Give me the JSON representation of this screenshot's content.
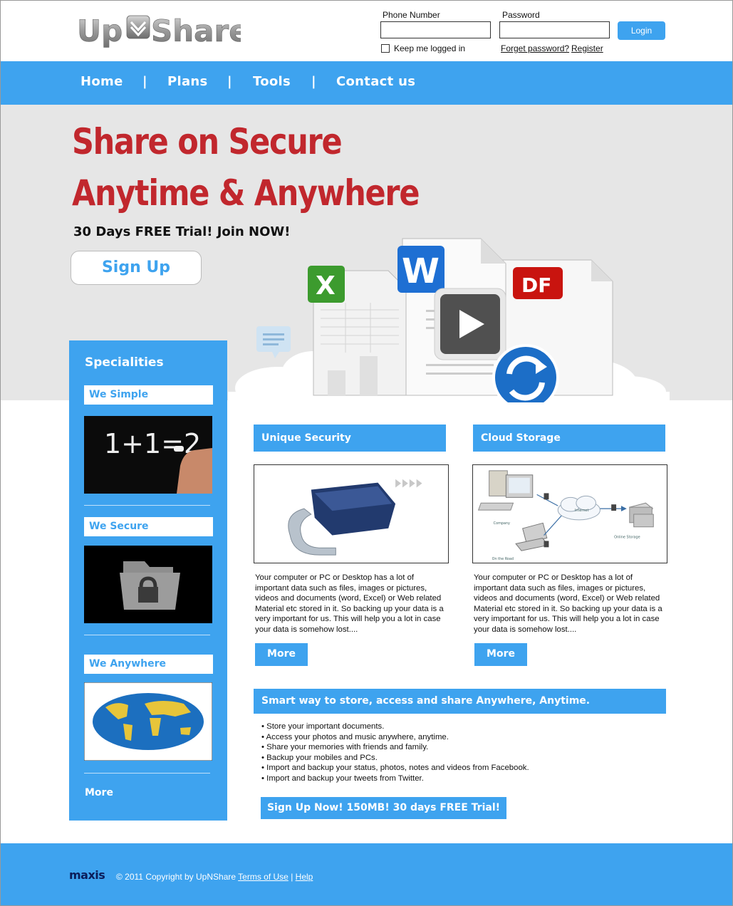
{
  "header": {
    "logo_text_left": "Up",
    "logo_text_right": "Share",
    "phone_label": "Phone Number",
    "password_label": "Password",
    "phone_value": "",
    "password_value": "",
    "login_label": "Login",
    "keep_logged_label": "Keep me logged in",
    "forgot_label": "Forget password?",
    "register_label": "Register"
  },
  "nav": {
    "items": [
      {
        "label": "Home"
      },
      {
        "label": "Plans"
      },
      {
        "label": "Tools"
      },
      {
        "label": "Contact us"
      }
    ],
    "separator": "|"
  },
  "hero": {
    "headline_1": "Share on Secure",
    "headline_2": "Anytime & Anywhere",
    "trial_text": "30 Days FREE Trial! Join NOW!",
    "signup_label": "Sign Up",
    "icon_excel": "X",
    "icon_word": "W",
    "icon_pdf": "DF"
  },
  "sidebar": {
    "title": "Specialities",
    "items": [
      {
        "label": "We Simple",
        "image_text": "1+1=2"
      },
      {
        "label": "We Secure"
      },
      {
        "label": "We Anywhere"
      }
    ],
    "more_label": "More"
  },
  "features": [
    {
      "title": "Unique Security",
      "text": "Your computer or PC or Desktop has a lot of important data such as files, images or pictures, videos and documents (word, Excel) or Web related Material etc stored in it. So backing up your data is a very important for us. This will help you a lot in case your data is somehow lost....",
      "more_label": "More"
    },
    {
      "title": "Cloud Storage",
      "text": "Your computer or PC or Desktop has a lot of important data such as files, images or pictures, videos and documents (word, Excel) or Web related Material etc stored in it. So backing up your data is a very important for us. This will help you a lot in case your data is somehow lost....",
      "more_label": "More",
      "diagram": {
        "internet": "Internet",
        "company": "Company",
        "on_the_road": "On the Road",
        "online_storage": "Online Storage"
      }
    }
  ],
  "smart": {
    "title": "Smart way to store, access and share Anywhere, Anytime.",
    "bullets": [
      "• Store your important documents.",
      "• Access your photos and music anywhere, anytime.",
      "• Share your memories with friends and family.",
      "• Backup your mobiles and PCs.",
      "• Import and backup your status, photos, notes and videos from Facebook.",
      "• Import and backup your tweets from Twitter."
    ],
    "cta_label": "Sign Up Now! 150MB! 30 days FREE Trial!"
  },
  "footer": {
    "brand": "maxis",
    "copyright": "© 2011 Copyright by UpNShare",
    "terms_label": "Terms of Use",
    "divider": "|",
    "help_label": "Help"
  },
  "colors": {
    "accent": "#3ea3ef",
    "headline": "#c1272d",
    "hero_bg": "#e6e6e6"
  }
}
